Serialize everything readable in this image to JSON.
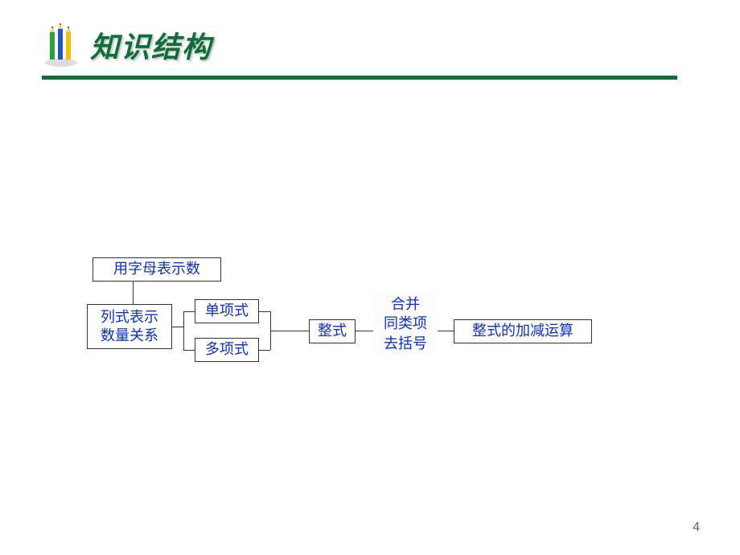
{
  "title": "知识结构",
  "nodes": {
    "top": "用字母表示数",
    "leftLine1": "列式表示",
    "leftLine2": "数量关系",
    "mono": "单项式",
    "poly": "多项式",
    "whole": "整式",
    "midLine1": "合并",
    "midLine2": "同类项",
    "midLine3": "去括号",
    "right": "整式的加减运算"
  },
  "pageNumber": "4"
}
